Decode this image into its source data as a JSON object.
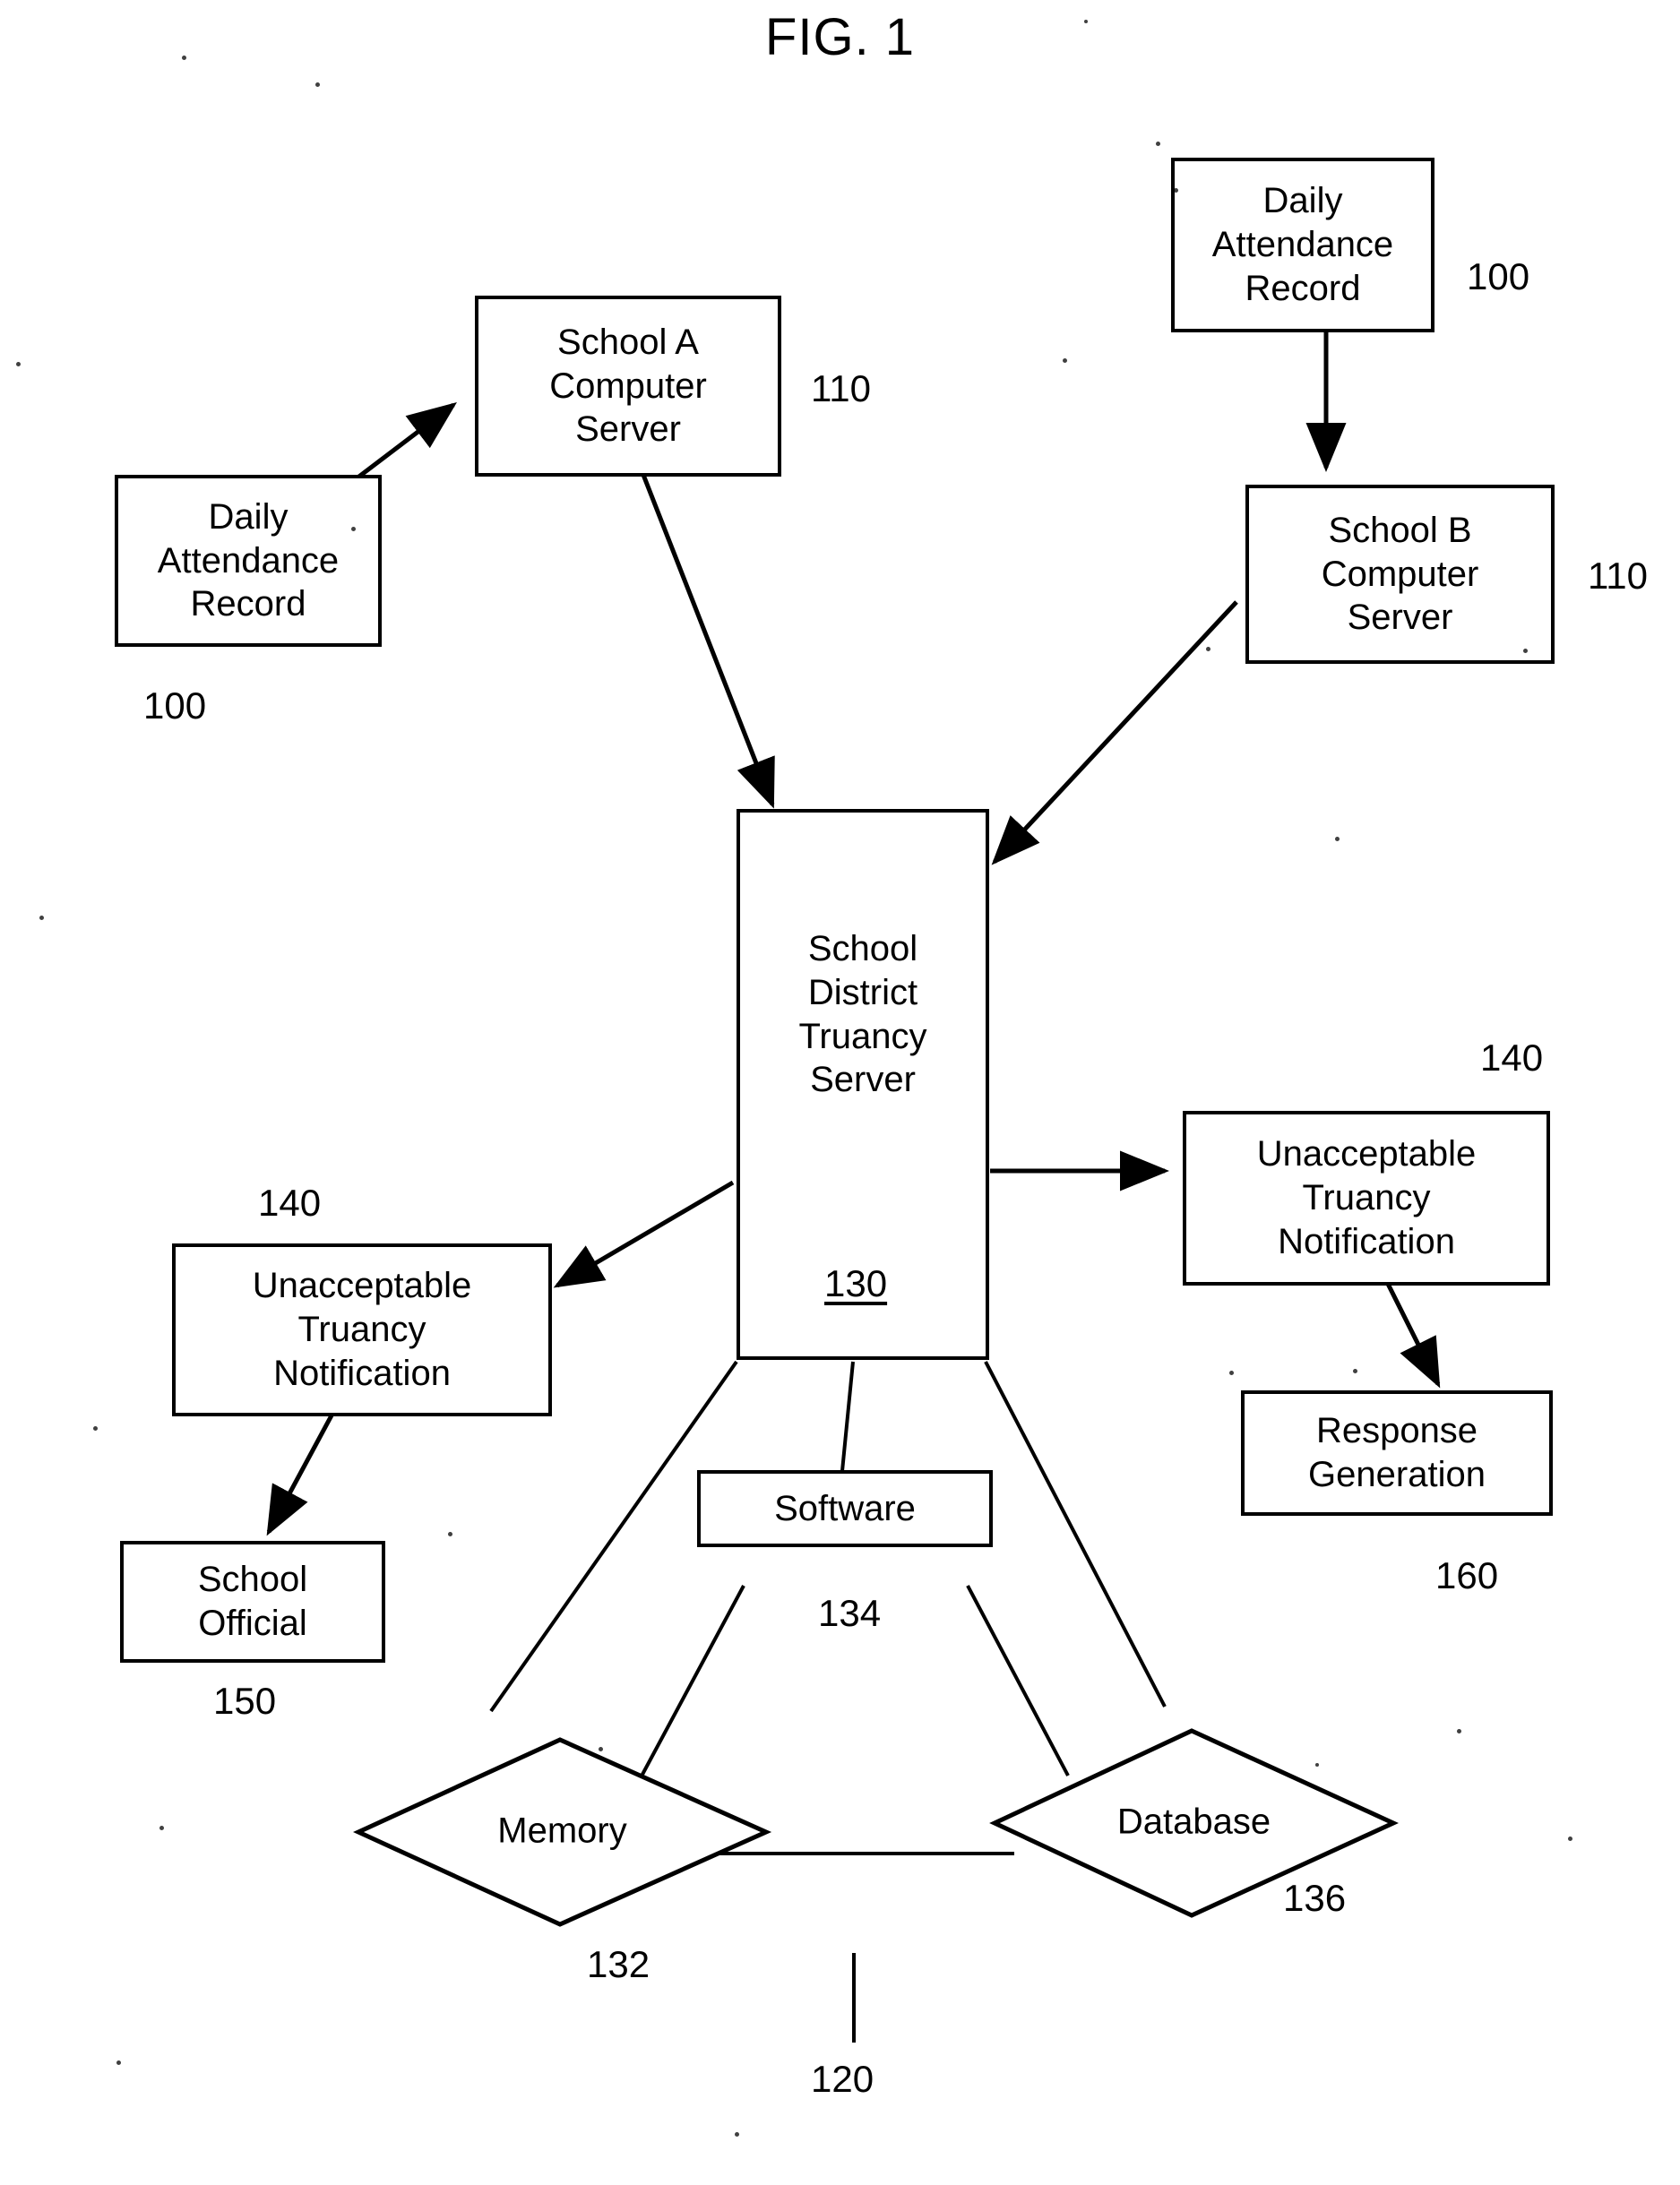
{
  "figure": {
    "title": "FIG. 1",
    "type": "patent-block-diagram"
  },
  "nodes": {
    "daily_attendance_record_right": {
      "label": "Daily\nAttendance\nRecord",
      "ref": "100"
    },
    "school_a_server": {
      "label": "School A\nComputer\nServer",
      "ref": "110"
    },
    "daily_attendance_record_left": {
      "label": "Daily\nAttendance\nRecord",
      "ref": "100"
    },
    "school_b_server": {
      "label": "School B\nComputer\nServer",
      "ref": "110"
    },
    "truancy_server": {
      "label": "School\nDistrict\nTruancy\nServer",
      "ref": "130"
    },
    "notification_right": {
      "label": "Unacceptable\nTruancy\nNotification",
      "ref": "140"
    },
    "notification_left": {
      "label": "Unacceptable\nTruancy\nNotification",
      "ref": "140"
    },
    "response_generation": {
      "label": "Response\nGeneration",
      "ref": "160"
    },
    "school_official": {
      "label": "School\nOfficial",
      "ref": "150"
    },
    "software": {
      "label": "Software",
      "ref": "134"
    },
    "memory": {
      "label": "Memory",
      "ref": "132"
    },
    "database": {
      "label": "Database",
      "ref": "136"
    },
    "system_bus": {
      "ref": "120"
    }
  },
  "refs": {
    "r100_right": "100",
    "r110_a": "110",
    "r100_left": "100",
    "r110_b": "110",
    "r130": "130",
    "r140_right": "140",
    "r140_left": "140",
    "r160": "160",
    "r150": "150",
    "r134": "134",
    "r132": "132",
    "r136": "136",
    "r120": "120"
  },
  "colors": {
    "stroke": "#000000",
    "background": "#ffffff"
  }
}
